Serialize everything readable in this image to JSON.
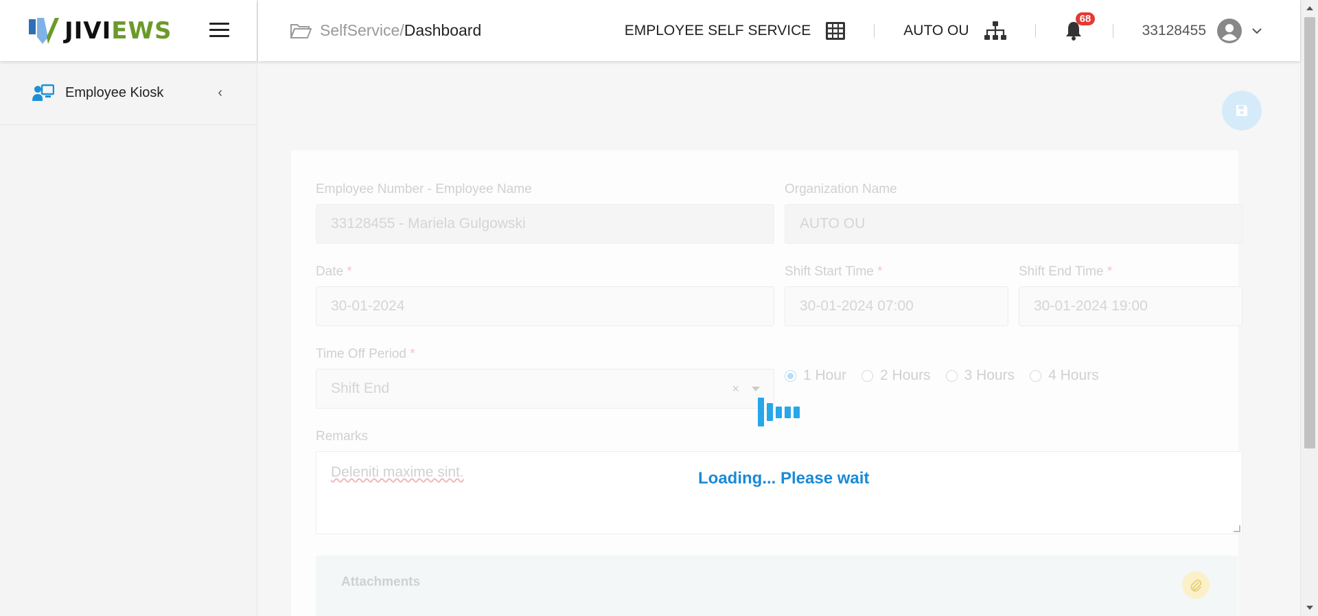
{
  "brand": {
    "text_a": "JIVI",
    "text_b": "EWS"
  },
  "sidebar": {
    "items": [
      {
        "label": "Employee Kiosk",
        "icon": "kiosk-icon"
      }
    ]
  },
  "breadcrumb": {
    "crumb1": "SelfService",
    "sep": "/",
    "crumb2": "Dashboard"
  },
  "topbar": {
    "module": "EMPLOYEE SELF SERVICE",
    "org": "AUTO OU",
    "notifications": "68",
    "user_id": "33128455"
  },
  "form": {
    "employee_label": "Employee Number - Employee Name",
    "employee_value": "33128455 - Mariela Gulgowski",
    "org_label": "Organization Name",
    "org_value": "AUTO OU",
    "date_label": "Date",
    "date_value": "30-01-2024",
    "shift_start_label": "Shift Start Time",
    "shift_start_value": "30-01-2024 07:00",
    "shift_end_label": "Shift End Time",
    "shift_end_value": "30-01-2024 19:00",
    "timeoff_label": "Time Off Period",
    "timeoff_value": "Shift End",
    "radio_options": [
      "1 Hour",
      "2 Hours",
      "3 Hours",
      "4 Hours"
    ],
    "radio_selected": "1 Hour",
    "remarks_label": "Remarks",
    "remarks_value": "Deleniti maxime sint.",
    "attachments_label": "Attachments",
    "required_mark": "*"
  },
  "loading": {
    "text": "Loading... Please wait"
  },
  "colors": {
    "brand_green": "#6b9a2a",
    "accent_blue": "#1a8ad6",
    "badge_red": "#e53935"
  }
}
